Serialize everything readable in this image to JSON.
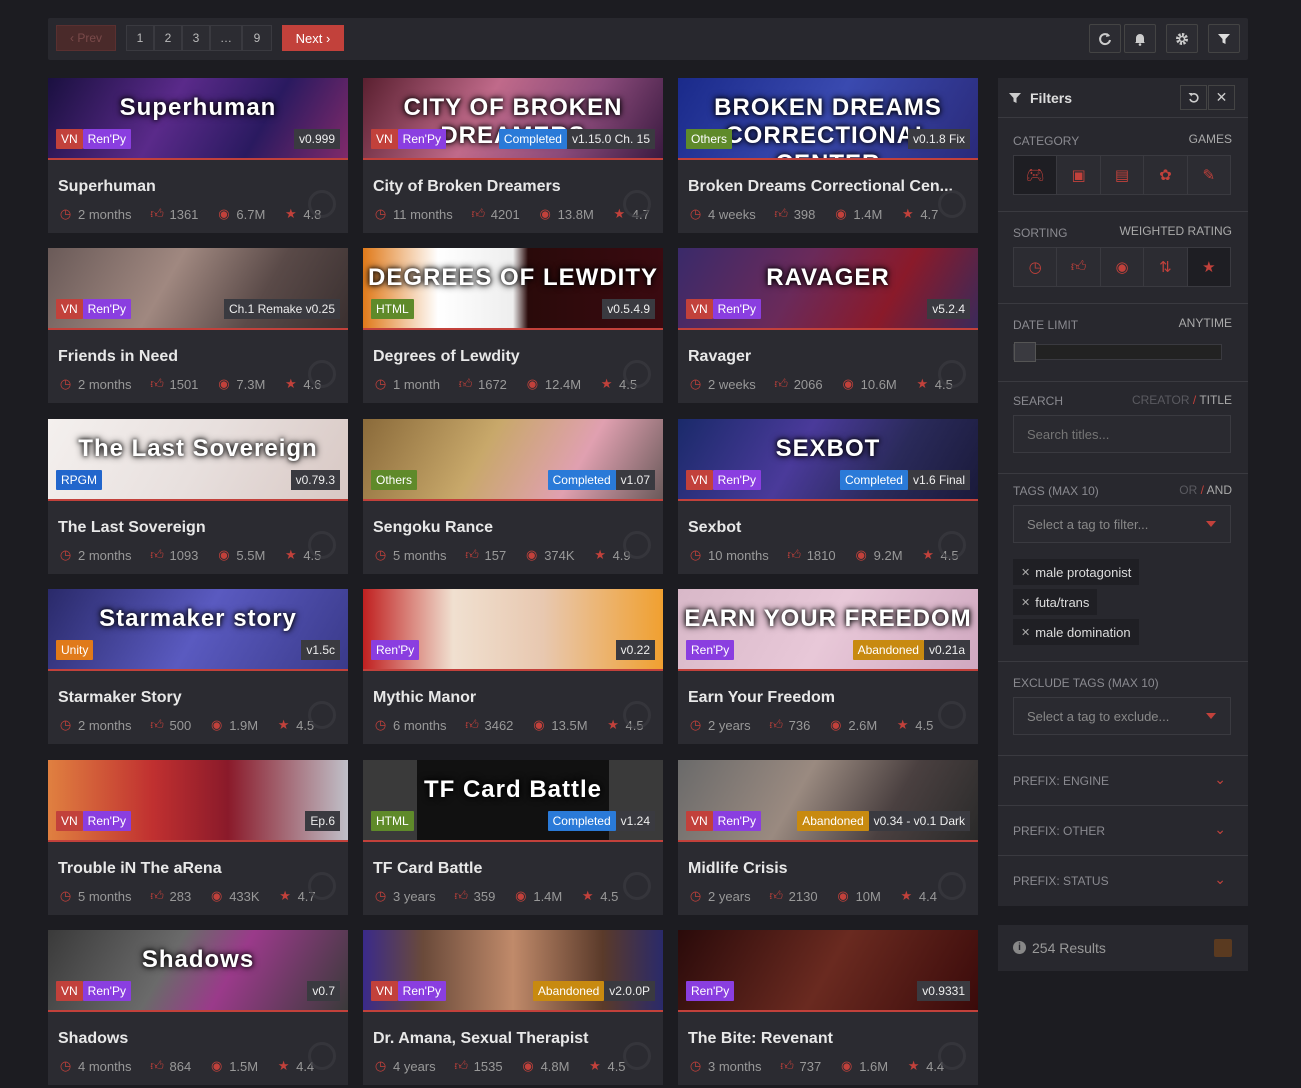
{
  "pagination": {
    "prev": "‹ Prev",
    "pages": [
      "1",
      "2",
      "3",
      "…",
      "9"
    ],
    "next": "Next ›"
  },
  "toolbar_icons": [
    "refresh-icon",
    "bell-icon",
    "gear-icon",
    "filter-icon"
  ],
  "cards": [
    {
      "title": "Superhuman",
      "banner": "Superhuman",
      "labels": [
        "VN",
        "Ren'Py"
      ],
      "status": "",
      "version": "v0.999",
      "time": "2 months",
      "likes": "1361",
      "views": "6.7M",
      "rating": "4.8",
      "art": "linear-gradient(120deg,#1a1040,#5a2a8a 40%,#2a1a60 70%,#802a6a)"
    },
    {
      "title": "City of Broken Dreamers",
      "banner": "CITY OF BROKEN DREAMERS",
      "labels": [
        "VN",
        "Ren'Py"
      ],
      "status": "Completed",
      "version": "v1.15.0 Ch. 15",
      "time": "11 months",
      "likes": "4201",
      "views": "13.8M",
      "rating": "4.7",
      "art": "linear-gradient(120deg,#5a2030,#c06a8a 40%,#8a4a7a 70%,#3a1a40)"
    },
    {
      "title": "Broken Dreams Correctional Cen...",
      "banner": "BROKEN DREAMS CORRECTIONAL CENTER",
      "labels": [
        "Others"
      ],
      "status": "",
      "version": "v0.1.8 Fix",
      "time": "4 weeks",
      "likes": "398",
      "views": "1.4M",
      "rating": "4.7",
      "art": "linear-gradient(120deg,#1a2a8a,#3a4ab0 50%,#2a2a7a)"
    },
    {
      "title": "Friends in Need",
      "banner": "",
      "labels": [
        "VN",
        "Ren'Py"
      ],
      "status": "",
      "version": "Ch.1 Remake v0.25",
      "time": "2 months",
      "likes": "1501",
      "views": "7.3M",
      "rating": "4.6",
      "art": "linear-gradient(120deg,#6a5a58,#a08880 40%,#5a4a48 70%,#3a3030)"
    },
    {
      "title": "Degrees of Lewdity",
      "banner": "DEGREES OF LEWDITY",
      "labels": [
        "HTML"
      ],
      "status": "",
      "version": "v0.5.4.9",
      "time": "1 month",
      "likes": "1672",
      "views": "12.4M",
      "rating": "4.5",
      "art": "linear-gradient(90deg,#e07a1a 0,#fff 25%,#eee 50%,#2a0a0a 55%,#3a0a10)"
    },
    {
      "title": "Ravager",
      "banner": "RAVAGER",
      "labels": [
        "VN",
        "Ren'Py"
      ],
      "status": "",
      "version": "v5.2.4",
      "time": "2 weeks",
      "likes": "2066",
      "views": "10.6M",
      "rating": "4.5",
      "art": "linear-gradient(120deg,#3a2a6a,#6a2a5a 40%,#8a1a2a 70%,#3a2a5a)"
    },
    {
      "title": "The Last Sovereign",
      "banner": "The Last Sovereign",
      "labels": [
        "RPGM"
      ],
      "status": "",
      "version": "v0.79.3",
      "time": "2 months",
      "likes": "1093",
      "views": "5.5M",
      "rating": "4.5",
      "art": "linear-gradient(120deg,#f4f0ee,#e8e0de 50%,#d8c8c4)"
    },
    {
      "title": "Sengoku Rance",
      "banner": "",
      "labels": [
        "Others"
      ],
      "status": "Completed",
      "version": "v1.07",
      "time": "5 months",
      "likes": "157",
      "views": "374K",
      "rating": "4.9",
      "art": "linear-gradient(120deg,#8a6a3a,#c8a86a 40%,#e0a0b0 70%,#6a5a5a)"
    },
    {
      "title": "Sexbot",
      "banner": "SEXBOT",
      "labels": [
        "VN",
        "Ren'Py"
      ],
      "status": "Completed",
      "version": "v1.6 Final",
      "time": "10 months",
      "likes": "1810",
      "views": "9.2M",
      "rating": "4.5",
      "art": "linear-gradient(120deg,#1a2a6a,#4a3a9a 40%,#2a2a5a 70%,#1a1a3a)"
    },
    {
      "title": "Starmaker Story",
      "banner": "Starmaker story",
      "labels": [
        "Unity"
      ],
      "status": "",
      "version": "v1.5c",
      "time": "2 months",
      "likes": "500",
      "views": "1.9M",
      "rating": "4.5",
      "art": "linear-gradient(120deg,#2a2a6a,#5a5ac0 50%,#3a3a8a)"
    },
    {
      "title": "Mythic Manor",
      "banner": "",
      "labels": [
        "Ren'Py"
      ],
      "status": "",
      "version": "v0.22",
      "time": "6 months",
      "likes": "3462",
      "views": "13.5M",
      "rating": "4.5",
      "art": "linear-gradient(90deg,#c02020,#f0e0d0 30%,#e8c8b0 60%,#f0a030)"
    },
    {
      "title": "Earn Your Freedom",
      "banner": "EARN YOUR FREEDOM",
      "labels": [
        "Ren'Py"
      ],
      "status": "Abandoned",
      "version": "v0.21a",
      "time": "2 years",
      "likes": "736",
      "views": "2.6M",
      "rating": "4.5",
      "art": "linear-gradient(120deg,#d8b8c8,#e8c8d8 50%,#d0a8c0)"
    },
    {
      "title": "Trouble iN The aRena",
      "banner": "",
      "labels": [
        "VN",
        "Ren'Py"
      ],
      "status": "",
      "version": "Ep.6",
      "time": "5 months",
      "likes": "283",
      "views": "433K",
      "rating": "4.7",
      "art": "linear-gradient(90deg,#e08040,#c03030 35%,#8a1a2a 60%,#c0c0c8)"
    },
    {
      "title": "TF Card Battle",
      "banner": "TF Card Battle",
      "labels": [
        "HTML"
      ],
      "status": "Completed",
      "version": "v1.24",
      "time": "3 years",
      "likes": "359",
      "views": "1.4M",
      "rating": "4.5",
      "art": "linear-gradient(90deg,#3a3a3a 0,#3a3a3a 18%,#111 18%,#111 82%,#3a3a3a 82%)"
    },
    {
      "title": "Midlife Crisis",
      "banner": "",
      "labels": [
        "VN",
        "Ren'Py"
      ],
      "status": "Abandoned",
      "version": "v0.34 - v0.1 Dark",
      "time": "2 years",
      "likes": "2130",
      "views": "10M",
      "rating": "4.4",
      "art": "linear-gradient(120deg,#6a6a6a,#9a8a80 40%,#4a4040 70%,#2a2a2a)"
    },
    {
      "title": "Shadows",
      "banner": "Shadows",
      "labels": [
        "VN",
        "Ren'Py"
      ],
      "status": "",
      "version": "v0.7",
      "time": "4 months",
      "likes": "864",
      "views": "1.5M",
      "rating": "4.4",
      "art": "linear-gradient(120deg,#3a3a3a,#6a6a6a 40%,#9a3a8a 60%,#3a3a3a)"
    },
    {
      "title": "Dr. Amana, Sexual Therapist",
      "banner": "",
      "labels": [
        "VN",
        "Ren'Py"
      ],
      "status": "Abandoned",
      "version": "v2.0.0P",
      "time": "4 years",
      "likes": "1535",
      "views": "4.8M",
      "rating": "4.5",
      "art": "linear-gradient(90deg,#3a2a8a,#6a4a3a 20%,#c08a6a 50%,#5a3a2a 80%,#2a2a6a)"
    },
    {
      "title": "The Bite: Revenant",
      "banner": "",
      "labels": [
        "Ren'Py"
      ],
      "status": "",
      "version": "v0.9331",
      "time": "3 months",
      "likes": "737",
      "views": "1.6M",
      "rating": "4.4",
      "art": "linear-gradient(120deg,#2a0a0a,#6a2a20 50%,#3a0a0a)"
    }
  ],
  "filters": {
    "title": "Filters",
    "category_label": "CATEGORY",
    "category_value": "GAMES",
    "category_icons": [
      "gamepad-icon",
      "image-icon",
      "film-icon",
      "comics-icon",
      "edit-icon"
    ],
    "sorting_label": "SORTING",
    "sorting_value": "WEIGHTED RATING",
    "sorting_icons": [
      "clock-icon",
      "thumbs-up-icon",
      "eye-icon",
      "sort-icon",
      "star-icon"
    ],
    "date_label": "DATE LIMIT",
    "date_value": "ANYTIME",
    "search_label": "SEARCH",
    "search_creator": "CREATOR",
    "search_slash": "/",
    "search_title": "TITLE",
    "search_placeholder": "Search titles...",
    "tags_label": "TAGS (MAX 10)",
    "tags_or": "OR",
    "tags_slash": "/",
    "tags_and": "AND",
    "tags_placeholder": "Select a tag to filter...",
    "tags": [
      "male protagonist",
      "futa/trans",
      "male domination"
    ],
    "exclude_label": "EXCLUDE TAGS (MAX 10)",
    "exclude_placeholder": "Select a tag to exclude...",
    "prefix_engine": "PREFIX: ENGINE",
    "prefix_other": "PREFIX: OTHER",
    "prefix_status": "PREFIX: STATUS"
  },
  "results": "254 Results",
  "colors": {
    "accent": "#c2413b",
    "bg": "#1c1c21",
    "panel": "#28282e"
  }
}
